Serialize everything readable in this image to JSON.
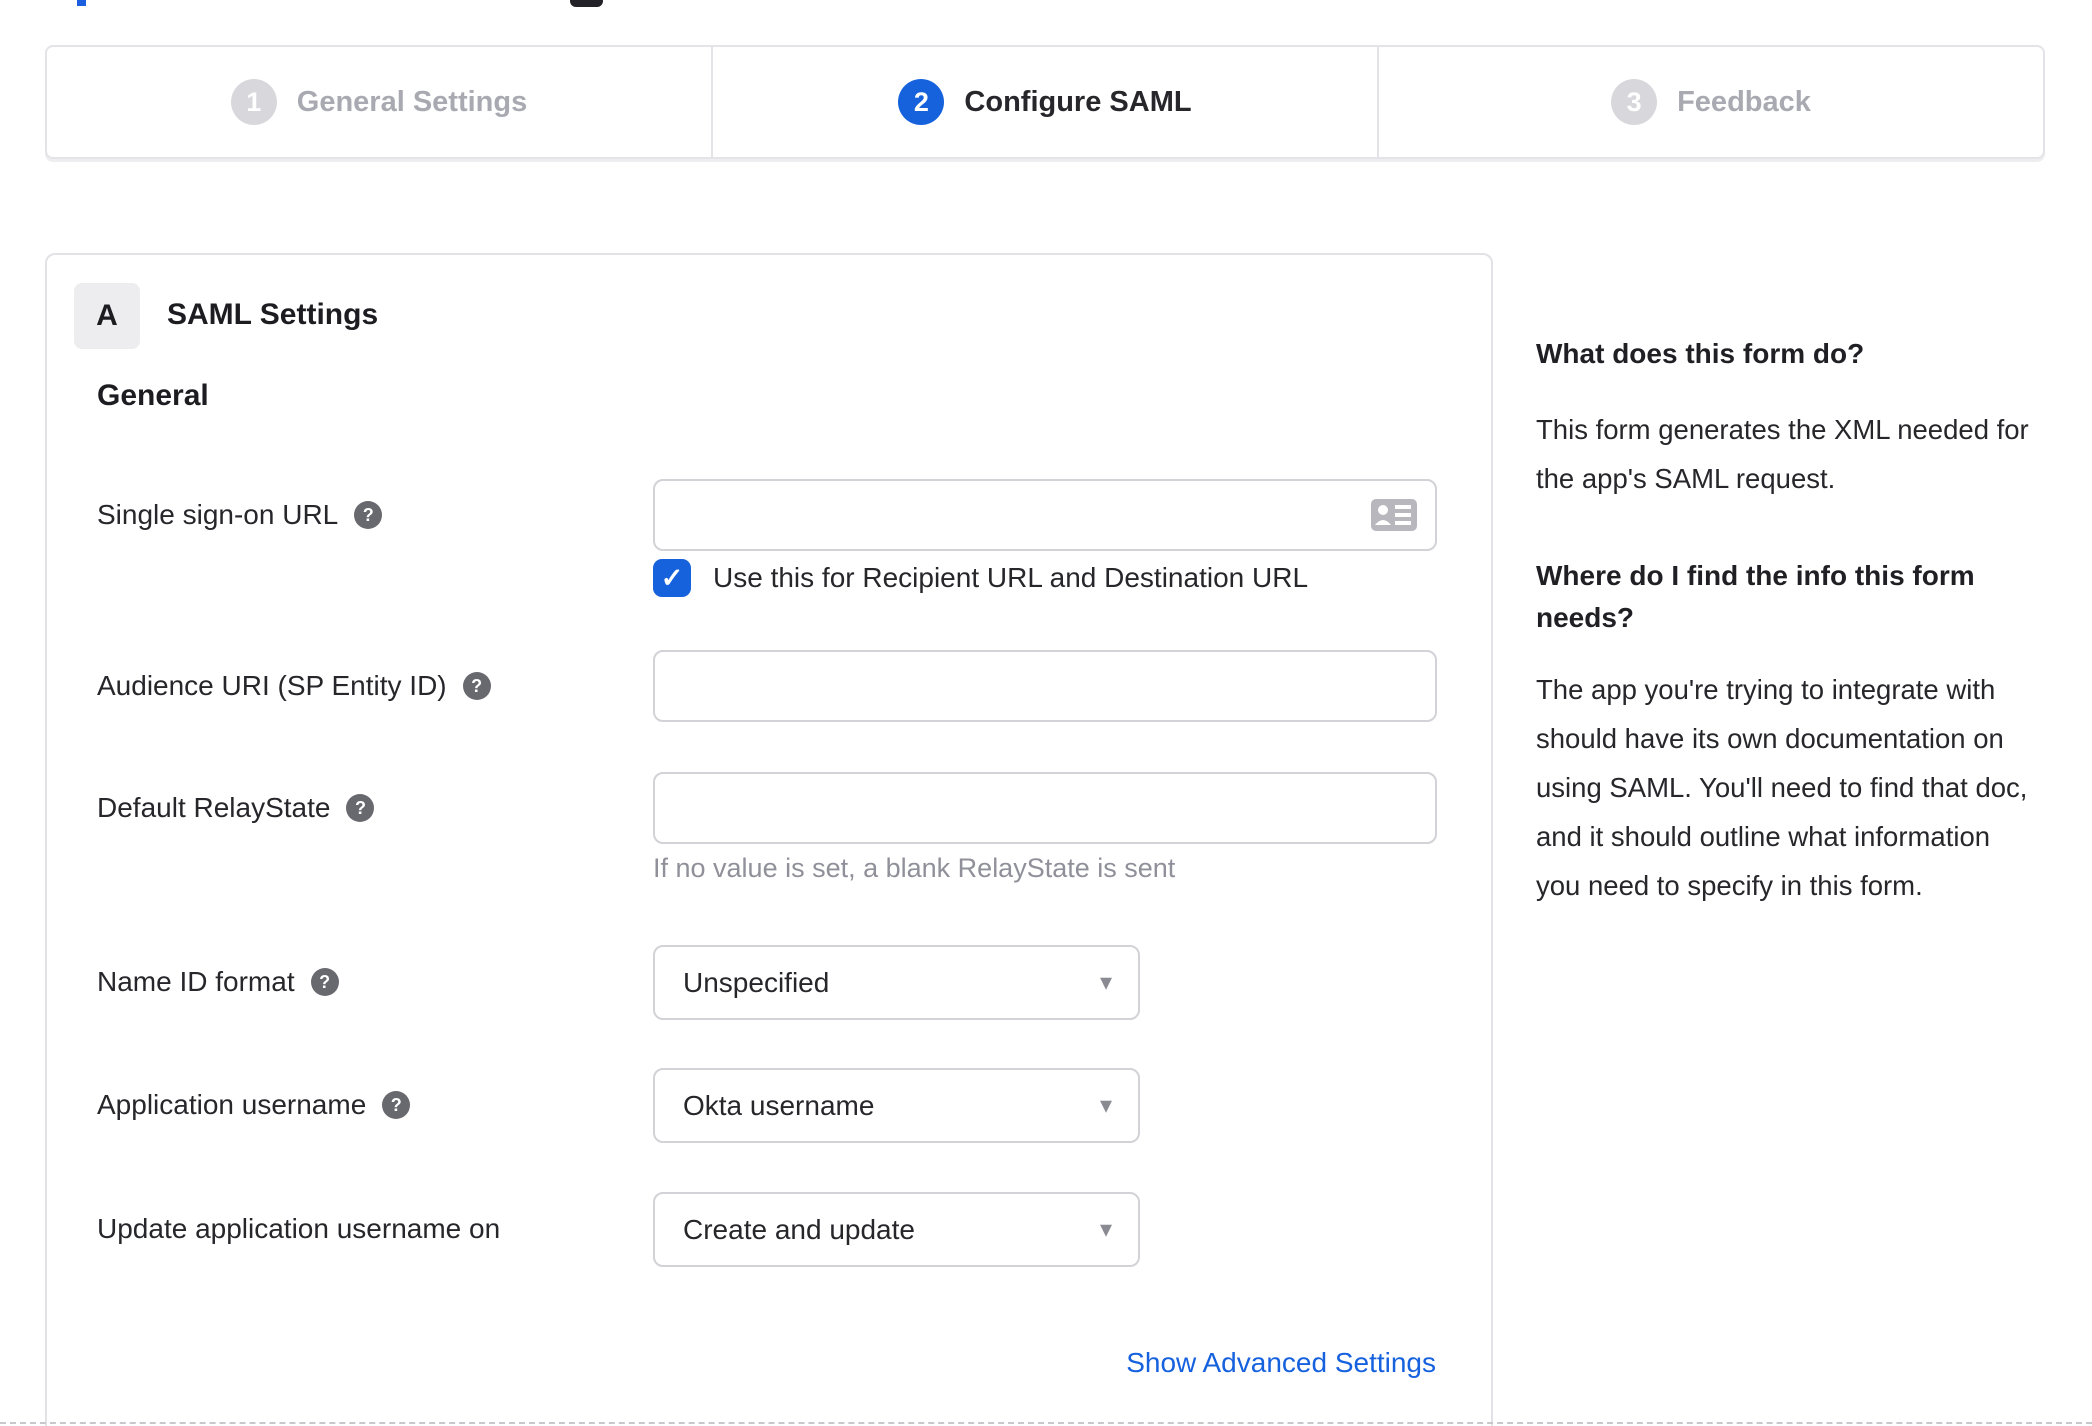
{
  "stepper": {
    "steps": [
      {
        "number": "1",
        "label": "General Settings",
        "active": false
      },
      {
        "number": "2",
        "label": "Configure SAML",
        "active": true
      },
      {
        "number": "3",
        "label": "Feedback",
        "active": false
      }
    ]
  },
  "panel": {
    "badge_letter": "A",
    "title": "SAML Settings",
    "section_heading": "General"
  },
  "form": {
    "sso": {
      "label": "Single sign-on URL",
      "value": "",
      "checkbox_label": "Use this for Recipient URL and Destination URL",
      "checked": true
    },
    "audience": {
      "label": "Audience URI (SP Entity ID)",
      "value": ""
    },
    "relaystate": {
      "label": "Default RelayState",
      "value": "",
      "hint": "If no value is set, a blank RelayState is sent"
    },
    "nameid": {
      "label": "Name ID format",
      "value": "Unspecified"
    },
    "appusername": {
      "label": "Application username",
      "value": "Okta username"
    },
    "updateusername": {
      "label": "Update application username on",
      "value": "Create and update"
    },
    "advanced_settings_link": "Show Advanced Settings"
  },
  "sidebar": {
    "q1": "What does this form do?",
    "a1": "This form generates the XML needed for the app's SAML request.",
    "q2": "Where do I find the info this form needs?",
    "a2": "The app you're trying to integrate with should have its own documentation on using SAML. You'll need to find that doc, and it should outline what information you need to specify in this form."
  },
  "icons": {
    "help_glyph": "?",
    "caret_glyph": "▾",
    "check_glyph": "✓"
  },
  "colors": {
    "accent_blue": "#1662dd",
    "link_blue": "#1661de",
    "inactive_gray": "#d7d7dc"
  }
}
